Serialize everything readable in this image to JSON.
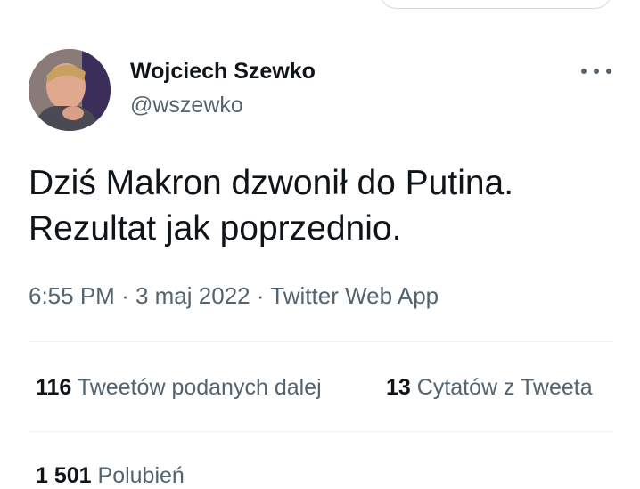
{
  "author": {
    "name": "Wojciech Szewko",
    "handle": "@wszewko",
    "avatar_icon": "person-portrait-avatar"
  },
  "tweet": {
    "lines": [
      "Dziś Makron dzwonił do Putina.",
      "Rezultat jak poprzednio."
    ],
    "time": "6:55 PM",
    "date": "3 maj 2022",
    "source": "Twitter Web App",
    "separator": "·"
  },
  "stats": {
    "retweets": {
      "count": "116",
      "label": "Tweetów podanych dalej"
    },
    "quotes": {
      "count": "13",
      "label": "Cytatów z Tweeta"
    },
    "likes": {
      "count": "1 501",
      "label": "Polubień"
    }
  },
  "icons": {
    "more": "more-dots-icon"
  },
  "colors": {
    "text": "#0f1419",
    "secondary": "#536471",
    "divider": "#eff3f4"
  }
}
